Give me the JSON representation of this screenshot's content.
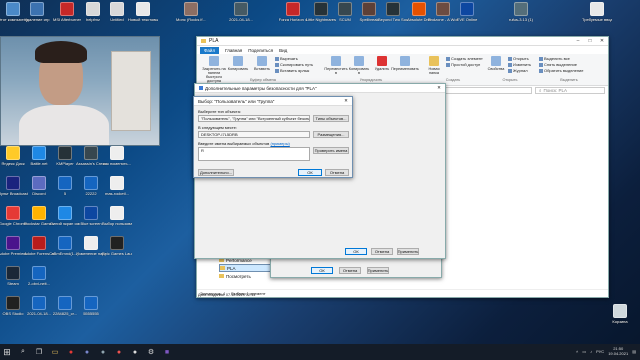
{
  "desktop": {
    "colors": {
      "taskbar": "#141c28",
      "accent": "#0078d7"
    },
    "top_icons": [
      {
        "label": "Этот компьютер",
        "color": "#4a89c8"
      },
      {
        "label": "Удаление игр",
        "color": "#3c72b0"
      },
      {
        "label": "MSI Afterburner",
        "color": "#c62828"
      },
      {
        "label": "helpfmz",
        "color": "#d8d8d8"
      },
      {
        "label": "Untitled",
        "color": "#d8d8d8"
      },
      {
        "label": "Новый текстовый ...",
        "color": "#e8e8e8"
      },
      {
        "label": "Мопс (Rocks it'...)",
        "color": "#8d6e63"
      },
      {
        "label": "2021-04-18...",
        "color": "#455a64"
      },
      {
        "label": "Forza Horizon 4",
        "color": "#c62828"
      },
      {
        "label": "Little Nightmares II",
        "color": "#263238"
      },
      {
        "label": "SCUM",
        "color": "#37474f"
      },
      {
        "label": "Spellbreak",
        "color": "#5d4037"
      },
      {
        "label": "Beyond Two Souls",
        "color": "#263238"
      },
      {
        "label": "Absolute Drift",
        "color": "#e65100"
      },
      {
        "label": "Endzone - A World Apart",
        "color": "#6d4c41"
      },
      {
        "label": "EVE Online",
        "color": "#0d47a1"
      },
      {
        "label": "rufus-3.13 (1)",
        "color": "#546e7a"
      },
      {
        "label": "Требуемые ввод ...",
        "color": "#e8e8e8"
      }
    ],
    "left_icons": [
      {
        "label": "Яндекс Диск",
        "color": "#ffca28"
      },
      {
        "label": "Battle.net",
        "color": "#1e88e5"
      },
      {
        "label": "KMPlayer",
        "color": "#263238"
      },
      {
        "label": "Assassin's Creed V...",
        "color": "#37474f"
      },
      {
        "label": "как поменять...",
        "color": "#eeeeee"
      },
      {
        "label": "Пульт Broadcaster",
        "color": "#1a237e"
      },
      {
        "label": "Discord",
        "color": "#5c6bc0"
      },
      {
        "label": "5",
        "color": "#1565c0"
      },
      {
        "label": "22222",
        "color": "#1565c0"
      },
      {
        "label": "mas-rocketl...",
        "color": "#eeeeee"
      },
      {
        "label": "Google Chrome",
        "color": "#e53935"
      },
      {
        "label": "Rockstar Games ...",
        "color": "#ffb300"
      },
      {
        "label": "Синий экран смерти прош...",
        "color": "#1e88e5"
      },
      {
        "label": "Blue screen",
        "color": "#0d47a1"
      },
      {
        "label": "Выбор пользоват...",
        "color": "#eeeeee"
      },
      {
        "label": "Adobe Premiere...",
        "color": "#4a148c"
      },
      {
        "label": "Adobe ForensCentral",
        "color": "#b71c1c"
      },
      {
        "label": "aBmErnnd(1...)",
        "color": "#1565c0"
      },
      {
        "label": "Изменение параметров...",
        "color": "#eeeeee"
      },
      {
        "label": "Epic Games Launcher",
        "color": "#212121"
      },
      {
        "label": "Steam",
        "color": "#1b2838"
      },
      {
        "label": "2-obvi-neit...",
        "color": "#1565c0"
      },
      {
        "label": "OBS Studio",
        "color": "#212121"
      },
      {
        "label": "2021-04-18...",
        "color": "#1565c0"
      },
      {
        "label": "2284825_cr...",
        "color": "#1565c0"
      },
      {
        "label": "5555555",
        "color": "#1565c0"
      }
    ],
    "right_icon": {
      "label": "Корзина"
    }
  },
  "explorer": {
    "title": "PLA",
    "tabs": [
      "Файл",
      "Главная",
      "Поделиться",
      "Вид"
    ],
    "ribbon": {
      "clipboard": {
        "pin": "Закрепить на панели быстрого доступа",
        "copy": "Копировать",
        "paste": "Вставить",
        "cut": "Вырезать",
        "copy_path": "Скопировать путь",
        "paste_shortcut": "Вставить ярлык",
        "caption": "Буфер обмена"
      },
      "organize": {
        "move": "Переместить в",
        "copy_to": "Копировать в",
        "delete": "Удалить",
        "rename": "Переименовать",
        "caption": "Упорядочить"
      },
      "new": {
        "new_folder": "Новая папка",
        "new_item": "Создать элемент",
        "easy_access": "Простой доступ",
        "caption": "Создать"
      },
      "open": {
        "properties": "Свойства",
        "open": "Открыть",
        "edit": "Изменить",
        "history": "Журнал",
        "caption": "Открыть"
      },
      "select": {
        "select_all": "Выделить все",
        "select_none": "Снять выделение",
        "invert": "Обратить выделение",
        "caption": "Выделить"
      }
    },
    "search_placeholder": "Поиск: PLA",
    "nav": [
      {
        "label": "PCHEALTH",
        "selected": false
      },
      {
        "label": "Performance",
        "selected": false
      },
      {
        "label": "PLA",
        "selected": true
      },
      {
        "label": "Посмотреть",
        "selected": false
      }
    ],
    "status_items": "Элементов: 4",
    "status_selected": "Выбран 1 элемент",
    "status_date": "Дата создания: 07.12.2019 12:14",
    "detail_label": "Сохранить"
  },
  "properties": {
    "tab_label": "Безопасность",
    "text_line1": "Разрешения",
    "text_line2": "администратора.",
    "ok": "ОК",
    "cancel": "Отмена",
    "apply": "Применить"
  },
  "advanced": {
    "title": "Дополнительные параметры безопасности для \"PLA\"",
    "ok": "ОК",
    "cancel": "Отмена",
    "apply": "Применить"
  },
  "select_dialog": {
    "title": "Выбор: \"Пользователь\" или \"Группа\"",
    "type_label": "Выберите тип объекта:",
    "type_value": "\"Пользователь\", \"Группа\" или \"Встроенный субъект безопасности\"",
    "types_button": "Типы объектов...",
    "location_label": "В следующем месте:",
    "location_value": "DESKTOP-I7L5DRB",
    "locations_button": "Размещения...",
    "names_label": "Введите имена выбираемых объектов",
    "examples_link": "(примеры)",
    "names_value": "R",
    "check_button": "Проверить имена",
    "advanced_button": "Дополнительно...",
    "ok": "ОК",
    "cancel": "Отмена"
  },
  "taskbar": {
    "lang": "РУС",
    "time": "21:50",
    "date": "19.04.2021"
  }
}
